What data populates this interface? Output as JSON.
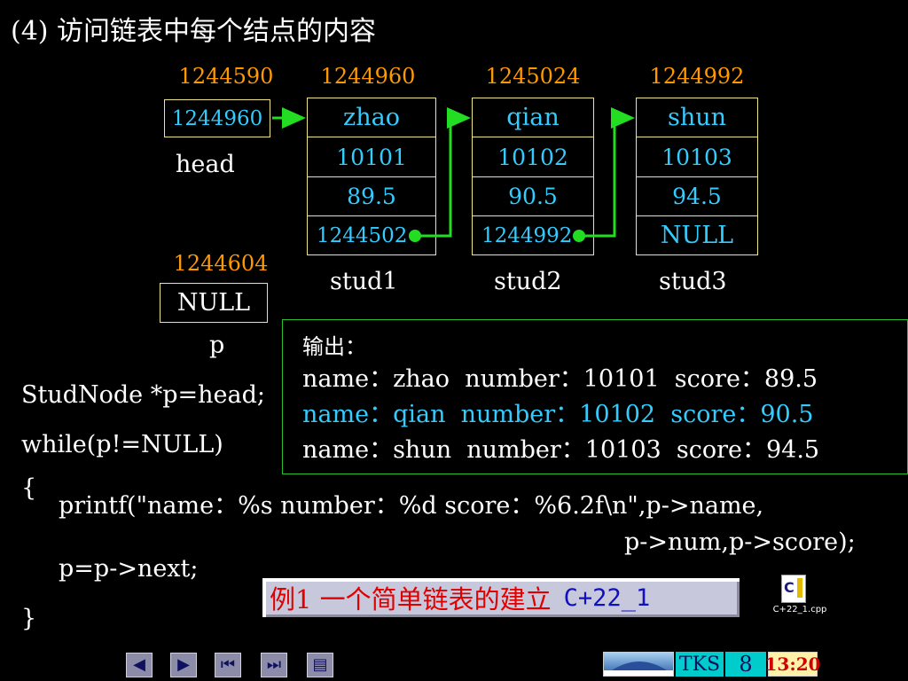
{
  "slide": {
    "title": "(4) 访问链表中每个结点的内容"
  },
  "head_var": {
    "address": "1244590",
    "value": "1244960",
    "label": "head"
  },
  "p_var": {
    "address": "1244604",
    "value": "NULL",
    "label": "p"
  },
  "nodes": [
    {
      "address": "1244960",
      "name": "zhao",
      "num": "10101",
      "score": "89.5",
      "next": "1244502",
      "label": "stud1"
    },
    {
      "address": "1245024",
      "name": "qian",
      "num": "10102",
      "score": "90.5",
      "next": "1244992",
      "label": "stud2"
    },
    {
      "address": "1244992",
      "name": "shun",
      "num": "10103",
      "score": "94.5",
      "next": "NULL",
      "label": "stud3"
    }
  ],
  "output": {
    "heading": "输出：",
    "lines": [
      "name：zhao  number：10101  score：89.5",
      "name：qian  number：10102  score：90.5",
      "name：shun  number：10103  score：94.5"
    ]
  },
  "code": {
    "line1": "StudNode *p=head;",
    "line2": "while(p!=NULL)",
    "line3": "{",
    "line4": "printf(\"name：%s  number：%d  score：%6.2f\\n\",p->name,",
    "line5": "p->num,p->score);",
    "line6": "p=p->next;",
    "line7": "}"
  },
  "example_button": {
    "text": "例1 一个简单链表的建立",
    "link": "C+22_1"
  },
  "file_icon": {
    "icon": "cpp-file-icon",
    "caption": "C+22_1.cpp"
  },
  "footer": {
    "brand": "TKS",
    "page": "8",
    "time": "13:20"
  },
  "nav": {
    "prev": "◀",
    "next": "▶",
    "first": "⏮",
    "last": "⏭",
    "doc": "▤"
  },
  "colors": {
    "address": "#ff9900",
    "cyan_text": "#33ccff",
    "box_border": "#f0e68c",
    "arrow": "#22dd22",
    "output_border": "#2bbf2b",
    "example_red": "#e00000",
    "example_blue": "#1010c0"
  }
}
